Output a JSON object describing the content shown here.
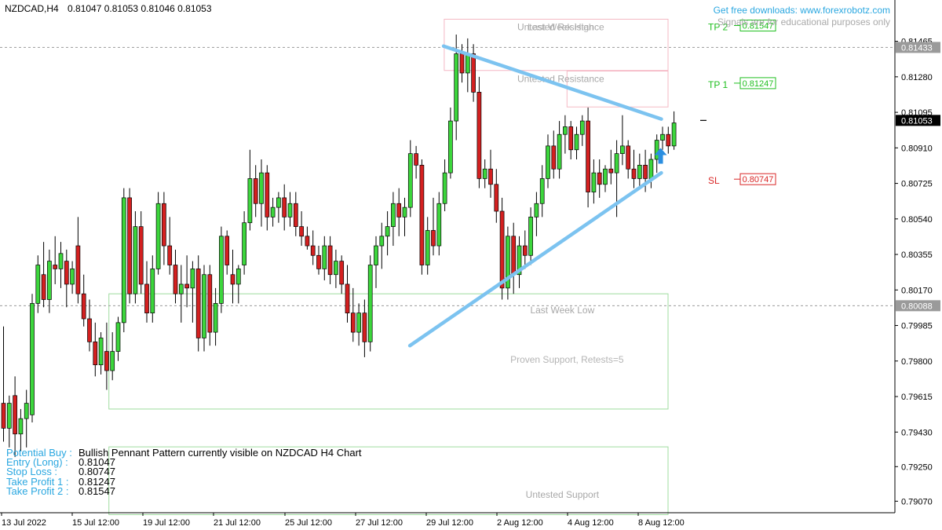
{
  "header": {
    "symbol": "NZDCAD,H4",
    "ohlc": "0.81047 0.81053 0.81046 0.81053"
  },
  "notices": {
    "download": "Get free downloads: www.forexrobotz.com",
    "educational": "Signals are for educational purposes only"
  },
  "info_panel": [
    {
      "label": "Potential Buy :",
      "value": "Bullish Pennant Pattern currently visible on NZDCAD H4 Chart"
    },
    {
      "label": "Entry (Long)  :",
      "value": "0.81047"
    },
    {
      "label": "Stop Loss     :",
      "value": "0.80747"
    },
    {
      "label": "Take Profit 1 :",
      "value": "0.81247"
    },
    {
      "label": "Take Profit 2 :",
      "value": "0.81547"
    }
  ],
  "chart_data": {
    "type": "candlestick",
    "symbol": "NZDCAD",
    "timeframe": "H4",
    "y_ticks": [
      0.81465,
      0.8128,
      0.81095,
      0.8091,
      0.80725,
      0.8054,
      0.80355,
      0.8017,
      0.79985,
      0.798,
      0.79615,
      0.7943,
      0.7925,
      0.7907
    ],
    "x_ticks": [
      "13 Jul 2022",
      "15 Jul 12:00",
      "19 Jul 12:00",
      "21 Jul 12:00",
      "25 Jul 12:00",
      "27 Jul 12:00",
      "29 Jul 12:00",
      "2 Aug 12:00",
      "4 Aug 12:00",
      "8 Aug 12:00"
    ],
    "ylim": [
      0.7901,
      0.8168
    ],
    "price_tags": [
      {
        "value": 0.81547,
        "label": "0.81547",
        "color": "#1fbf1f"
      },
      {
        "value": 0.81433,
        "label": "0.81433",
        "color": "#9a9a9a"
      },
      {
        "value": 0.81247,
        "label": "0.81247",
        "color": "#1fbf1f"
      },
      {
        "value": 0.81053,
        "label": "0.81053",
        "color": "#000000"
      },
      {
        "value": 0.80747,
        "label": "0.80747",
        "color": "#d92626"
      },
      {
        "value": 0.80088,
        "label": "0.80088",
        "color": "#9a9a9a"
      }
    ],
    "levels": [
      {
        "name": "TP 1",
        "value": 0.81247,
        "color": "#1fbf1f"
      },
      {
        "name": "TP 2",
        "value": 0.81547,
        "color": "#1fbf1f"
      },
      {
        "name": "SL",
        "value": 0.80747,
        "color": "#d92626"
      }
    ],
    "dotted_lines": [
      0.81433,
      0.80088
    ],
    "zones": [
      {
        "label": "Untested Resistance",
        "label2": "Last Week High",
        "top": 0.8158,
        "bottom": 0.81313,
        "x_from": 0.4964,
        "x_to": 0.7465,
        "color": "#f5b8c4"
      },
      {
        "label": "Untested Resistance",
        "top": 0.8131,
        "bottom": 0.81123,
        "x_from": 0.6336,
        "x_to": 0.7465,
        "color": "#f5b8c4"
      },
      {
        "label": "Last Week Low",
        "label2": "Proven Support, Retests=5",
        "top": 0.8015,
        "bottom": 0.7955,
        "x_from": 0.1217,
        "x_to": 0.7465,
        "color": "#9fdc9f"
      },
      {
        "label": "Untested Support",
        "top": 0.79353,
        "bottom": 0.79,
        "x_from": 0.1217,
        "x_to": 0.7465,
        "color": "#9fdc9f"
      }
    ],
    "pennant": [
      {
        "from": [
          0.4957,
          0.8144
        ],
        "to": [
          0.739,
          0.8106
        ]
      },
      {
        "from": [
          0.458,
          0.7988
        ],
        "to": [
          0.739,
          0.8078
        ]
      }
    ],
    "signal": {
      "type": "buy-arrow",
      "x": 0.7382,
      "value": 0.8086
    },
    "candles": [
      {
        "o": 0.7958,
        "h": 0.7998,
        "l": 0.7938,
        "c": 0.7945
      },
      {
        "o": 0.7945,
        "h": 0.7962,
        "l": 0.7935,
        "c": 0.7958
      },
      {
        "o": 0.7962,
        "h": 0.7972,
        "l": 0.793,
        "c": 0.7942
      },
      {
        "o": 0.7942,
        "h": 0.7955,
        "l": 0.7933,
        "c": 0.795
      },
      {
        "o": 0.795,
        "h": 0.7965,
        "l": 0.7935,
        "c": 0.7958
      },
      {
        "o": 0.7952,
        "h": 0.8015,
        "l": 0.7948,
        "c": 0.801
      },
      {
        "o": 0.801,
        "h": 0.8035,
        "l": 0.8005,
        "c": 0.803
      },
      {
        "o": 0.8025,
        "h": 0.8042,
        "l": 0.8008,
        "c": 0.8012
      },
      {
        "o": 0.8012,
        "h": 0.8038,
        "l": 0.8005,
        "c": 0.8032
      },
      {
        "o": 0.803,
        "h": 0.8045,
        "l": 0.802,
        "c": 0.8028
      },
      {
        "o": 0.8028,
        "h": 0.8042,
        "l": 0.8018,
        "c": 0.8036
      },
      {
        "o": 0.8032,
        "h": 0.8038,
        "l": 0.8008,
        "c": 0.802
      },
      {
        "o": 0.802,
        "h": 0.8032,
        "l": 0.8015,
        "c": 0.8028
      },
      {
        "o": 0.804,
        "h": 0.8055,
        "l": 0.801,
        "c": 0.8015
      },
      {
        "o": 0.8015,
        "h": 0.8025,
        "l": 0.7998,
        "c": 0.8002
      },
      {
        "o": 0.8002,
        "h": 0.8012,
        "l": 0.7985,
        "c": 0.799
      },
      {
        "o": 0.799,
        "h": 0.8,
        "l": 0.7972,
        "c": 0.7978
      },
      {
        "o": 0.7978,
        "h": 0.7995,
        "l": 0.7973,
        "c": 0.7992
      },
      {
        "o": 0.7985,
        "h": 0.8,
        "l": 0.7965,
        "c": 0.7975
      },
      {
        "o": 0.7975,
        "h": 0.7995,
        "l": 0.797,
        "c": 0.7985
      },
      {
        "o": 0.7985,
        "h": 0.8003,
        "l": 0.798,
        "c": 0.8
      },
      {
        "o": 0.8,
        "h": 0.807,
        "l": 0.7995,
        "c": 0.8065
      },
      {
        "o": 0.8065,
        "h": 0.807,
        "l": 0.801,
        "c": 0.8015
      },
      {
        "o": 0.8015,
        "h": 0.8058,
        "l": 0.801,
        "c": 0.805
      },
      {
        "o": 0.805,
        "h": 0.8058,
        "l": 0.8015,
        "c": 0.802
      },
      {
        "o": 0.802,
        "h": 0.8032,
        "l": 0.8,
        "c": 0.8005
      },
      {
        "o": 0.8005,
        "h": 0.8035,
        "l": 0.8,
        "c": 0.8028
      },
      {
        "o": 0.8028,
        "h": 0.8068,
        "l": 0.8025,
        "c": 0.8062
      },
      {
        "o": 0.8062,
        "h": 0.8068,
        "l": 0.803,
        "c": 0.804
      },
      {
        "o": 0.804,
        "h": 0.8055,
        "l": 0.8025,
        "c": 0.803
      },
      {
        "o": 0.803,
        "h": 0.8038,
        "l": 0.801,
        "c": 0.8015
      },
      {
        "o": 0.8015,
        "h": 0.803,
        "l": 0.8,
        "c": 0.802
      },
      {
        "o": 0.802,
        "h": 0.8035,
        "l": 0.8008,
        "c": 0.8018
      },
      {
        "o": 0.8018,
        "h": 0.8032,
        "l": 0.8,
        "c": 0.8028
      },
      {
        "o": 0.8028,
        "h": 0.8035,
        "l": 0.7985,
        "c": 0.7992
      },
      {
        "o": 0.7992,
        "h": 0.803,
        "l": 0.7985,
        "c": 0.8025
      },
      {
        "o": 0.8025,
        "h": 0.803,
        "l": 0.7988,
        "c": 0.7995
      },
      {
        "o": 0.7995,
        "h": 0.8018,
        "l": 0.7988,
        "c": 0.801
      },
      {
        "o": 0.801,
        "h": 0.805,
        "l": 0.8005,
        "c": 0.8045
      },
      {
        "o": 0.8045,
        "h": 0.8048,
        "l": 0.8025,
        "c": 0.803
      },
      {
        "o": 0.8025,
        "h": 0.8038,
        "l": 0.801,
        "c": 0.802
      },
      {
        "o": 0.802,
        "h": 0.803,
        "l": 0.801,
        "c": 0.8028
      },
      {
        "o": 0.803,
        "h": 0.8058,
        "l": 0.8025,
        "c": 0.8052
      },
      {
        "o": 0.8052,
        "h": 0.809,
        "l": 0.8048,
        "c": 0.8075
      },
      {
        "o": 0.8075,
        "h": 0.8082,
        "l": 0.8055,
        "c": 0.8062
      },
      {
        "o": 0.8062,
        "h": 0.8085,
        "l": 0.805,
        "c": 0.8078
      },
      {
        "o": 0.8078,
        "h": 0.8082,
        "l": 0.8048,
        "c": 0.8055
      },
      {
        "o": 0.8055,
        "h": 0.8065,
        "l": 0.805,
        "c": 0.806
      },
      {
        "o": 0.806,
        "h": 0.8068,
        "l": 0.8052,
        "c": 0.8065
      },
      {
        "o": 0.8065,
        "h": 0.8072,
        "l": 0.8048,
        "c": 0.8055
      },
      {
        "o": 0.8055,
        "h": 0.8068,
        "l": 0.805,
        "c": 0.8062
      },
      {
        "o": 0.8062,
        "h": 0.8068,
        "l": 0.8045,
        "c": 0.805
      },
      {
        "o": 0.805,
        "h": 0.8058,
        "l": 0.804,
        "c": 0.8045
      },
      {
        "o": 0.8045,
        "h": 0.805,
        "l": 0.8038,
        "c": 0.804
      },
      {
        "o": 0.804,
        "h": 0.8048,
        "l": 0.803,
        "c": 0.8035
      },
      {
        "o": 0.8035,
        "h": 0.804,
        "l": 0.8025,
        "c": 0.8028
      },
      {
        "o": 0.8028,
        "h": 0.8045,
        "l": 0.8022,
        "c": 0.804
      },
      {
        "o": 0.804,
        "h": 0.8045,
        "l": 0.802,
        "c": 0.8025
      },
      {
        "o": 0.8025,
        "h": 0.8038,
        "l": 0.8018,
        "c": 0.8032
      },
      {
        "o": 0.8032,
        "h": 0.8035,
        "l": 0.8015,
        "c": 0.802
      },
      {
        "o": 0.802,
        "h": 0.803,
        "l": 0.8,
        "c": 0.8005
      },
      {
        "o": 0.8005,
        "h": 0.8018,
        "l": 0.799,
        "c": 0.7995
      },
      {
        "o": 0.7995,
        "h": 0.801,
        "l": 0.7988,
        "c": 0.8005
      },
      {
        "o": 0.8005,
        "h": 0.8012,
        "l": 0.7982,
        "c": 0.799
      },
      {
        "o": 0.799,
        "h": 0.8035,
        "l": 0.7985,
        "c": 0.803
      },
      {
        "o": 0.803,
        "h": 0.8045,
        "l": 0.8018,
        "c": 0.804
      },
      {
        "o": 0.804,
        "h": 0.8052,
        "l": 0.8028,
        "c": 0.8045
      },
      {
        "o": 0.8045,
        "h": 0.8058,
        "l": 0.8035,
        "c": 0.805
      },
      {
        "o": 0.805,
        "h": 0.8068,
        "l": 0.804,
        "c": 0.8062
      },
      {
        "o": 0.8062,
        "h": 0.807,
        "l": 0.8045,
        "c": 0.8055
      },
      {
        "o": 0.8055,
        "h": 0.8065,
        "l": 0.8045,
        "c": 0.806
      },
      {
        "o": 0.806,
        "h": 0.8095,
        "l": 0.8055,
        "c": 0.8088
      },
      {
        "o": 0.8088,
        "h": 0.8092,
        "l": 0.8075,
        "c": 0.8082
      },
      {
        "o": 0.8082,
        "h": 0.8085,
        "l": 0.8025,
        "c": 0.803
      },
      {
        "o": 0.803,
        "h": 0.8055,
        "l": 0.8025,
        "c": 0.8048
      },
      {
        "o": 0.8048,
        "h": 0.8065,
        "l": 0.8035,
        "c": 0.804
      },
      {
        "o": 0.804,
        "h": 0.8068,
        "l": 0.8035,
        "c": 0.8062
      },
      {
        "o": 0.8062,
        "h": 0.8085,
        "l": 0.8058,
        "c": 0.8078
      },
      {
        "o": 0.8078,
        "h": 0.8112,
        "l": 0.8075,
        "c": 0.8105
      },
      {
        "o": 0.8105,
        "h": 0.815,
        "l": 0.8095,
        "c": 0.814
      },
      {
        "o": 0.814,
        "h": 0.8145,
        "l": 0.8125,
        "c": 0.813
      },
      {
        "o": 0.813,
        "h": 0.8148,
        "l": 0.812,
        "c": 0.814
      },
      {
        "o": 0.814,
        "h": 0.8145,
        "l": 0.8115,
        "c": 0.812
      },
      {
        "o": 0.812,
        "h": 0.8128,
        "l": 0.807,
        "c": 0.8075
      },
      {
        "o": 0.8075,
        "h": 0.8085,
        "l": 0.807,
        "c": 0.808
      },
      {
        "o": 0.808,
        "h": 0.809,
        "l": 0.8065,
        "c": 0.8072
      },
      {
        "o": 0.8072,
        "h": 0.808,
        "l": 0.8052,
        "c": 0.8058
      },
      {
        "o": 0.8058,
        "h": 0.8065,
        "l": 0.8012,
        "c": 0.8018
      },
      {
        "o": 0.8018,
        "h": 0.805,
        "l": 0.8012,
        "c": 0.8045
      },
      {
        "o": 0.8045,
        "h": 0.8052,
        "l": 0.8015,
        "c": 0.8025
      },
      {
        "o": 0.8025,
        "h": 0.8045,
        "l": 0.8018,
        "c": 0.804
      },
      {
        "o": 0.804,
        "h": 0.8048,
        "l": 0.8028,
        "c": 0.8035
      },
      {
        "o": 0.8035,
        "h": 0.806,
        "l": 0.803,
        "c": 0.8055
      },
      {
        "o": 0.8055,
        "h": 0.8068,
        "l": 0.8045,
        "c": 0.8062
      },
      {
        "o": 0.8062,
        "h": 0.8082,
        "l": 0.8055,
        "c": 0.8075
      },
      {
        "o": 0.8075,
        "h": 0.8098,
        "l": 0.807,
        "c": 0.8092
      },
      {
        "o": 0.8092,
        "h": 0.81,
        "l": 0.8075,
        "c": 0.808
      },
      {
        "o": 0.808,
        "h": 0.8105,
        "l": 0.8075,
        "c": 0.8098
      },
      {
        "o": 0.8098,
        "h": 0.8108,
        "l": 0.8088,
        "c": 0.8102
      },
      {
        "o": 0.8102,
        "h": 0.8105,
        "l": 0.8085,
        "c": 0.809
      },
      {
        "o": 0.809,
        "h": 0.8102,
        "l": 0.8085,
        "c": 0.8098
      },
      {
        "o": 0.8098,
        "h": 0.8108,
        "l": 0.8092,
        "c": 0.8105
      },
      {
        "o": 0.8105,
        "h": 0.8112,
        "l": 0.806,
        "c": 0.8068
      },
      {
        "o": 0.8068,
        "h": 0.8085,
        "l": 0.8062,
        "c": 0.8078
      },
      {
        "o": 0.8078,
        "h": 0.8085,
        "l": 0.8065,
        "c": 0.8072
      },
      {
        "o": 0.8072,
        "h": 0.8082,
        "l": 0.8068,
        "c": 0.808
      },
      {
        "o": 0.808,
        "h": 0.809,
        "l": 0.8072,
        "c": 0.8078
      },
      {
        "o": 0.8078,
        "h": 0.8095,
        "l": 0.8055,
        "c": 0.8088
      },
      {
        "o": 0.8088,
        "h": 0.8108,
        "l": 0.8082,
        "c": 0.8092
      },
      {
        "o": 0.8092,
        "h": 0.8095,
        "l": 0.8075,
        "c": 0.808
      },
      {
        "o": 0.808,
        "h": 0.809,
        "l": 0.807,
        "c": 0.8075
      },
      {
        "o": 0.8075,
        "h": 0.8088,
        "l": 0.807,
        "c": 0.8082
      },
      {
        "o": 0.8082,
        "h": 0.809,
        "l": 0.8068,
        "c": 0.8075
      },
      {
        "o": 0.8075,
        "h": 0.8088,
        "l": 0.807,
        "c": 0.8085
      },
      {
        "o": 0.8085,
        "h": 0.8098,
        "l": 0.8078,
        "c": 0.8095
      },
      {
        "o": 0.8095,
        "h": 0.8102,
        "l": 0.809,
        "c": 0.8098
      },
      {
        "o": 0.8098,
        "h": 0.8102,
        "l": 0.8088,
        "c": 0.8092
      },
      {
        "o": 0.8092,
        "h": 0.811,
        "l": 0.809,
        "c": 0.8104
      }
    ]
  }
}
